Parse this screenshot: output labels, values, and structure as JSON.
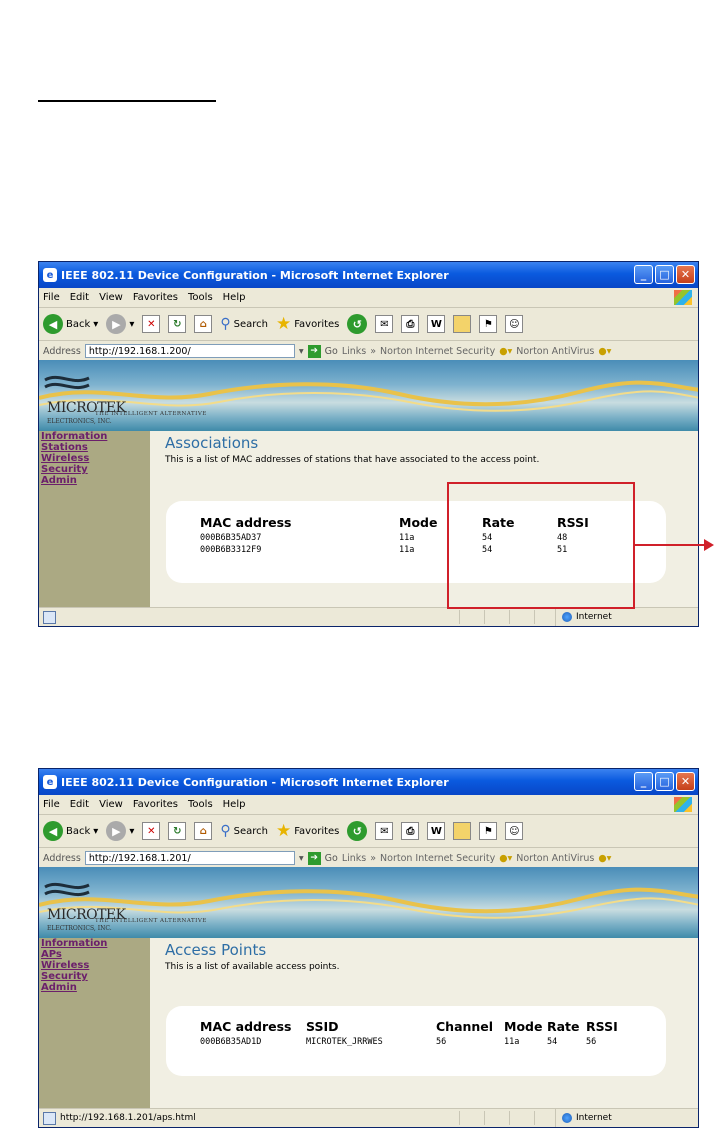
{
  "windows": [
    {
      "title": "IEEE 802.11 Device Configuration - Microsoft Internet Explorer",
      "menu": [
        "File",
        "Edit",
        "View",
        "Favorites",
        "Tools",
        "Help"
      ],
      "toolbar": {
        "back": "Back",
        "search": "Search",
        "favorites": "Favorites"
      },
      "address": {
        "label": "Address",
        "value": "http://192.168.1.200/",
        "go": "Go",
        "links": "Links",
        "ext1": "Norton Internet Security",
        "ext2": "Norton AntiVirus"
      },
      "brand": {
        "logo": "MICROTEK",
        "logo_sub": "ELECTRONICS, INC.",
        "tagline": "THE INTELLIGENT ALTERNATIVE"
      },
      "sidebar": [
        "Information",
        "Stations",
        "Wireless",
        "Security",
        "Admin"
      ],
      "page": {
        "title": "Associations",
        "description": "This is a list of MAC addresses of stations that have associated to the access point."
      },
      "table": {
        "headers": [
          "MAC address",
          "Mode",
          "Rate",
          "RSSI"
        ],
        "rows": [
          [
            "000B6B35AD37",
            "11a",
            "54",
            "48"
          ],
          [
            "000B6B3312F9",
            "11a",
            "54",
            "51"
          ]
        ]
      },
      "status": {
        "left": "",
        "zone": "Internet"
      }
    },
    {
      "title": "IEEE 802.11 Device Configuration - Microsoft Internet Explorer",
      "menu": [
        "File",
        "Edit",
        "View",
        "Favorites",
        "Tools",
        "Help"
      ],
      "toolbar": {
        "back": "Back",
        "search": "Search",
        "favorites": "Favorites"
      },
      "address": {
        "label": "Address",
        "value": "http://192.168.1.201/",
        "go": "Go",
        "links": "Links",
        "ext1": "Norton Internet Security",
        "ext2": "Norton AntiVirus"
      },
      "brand": {
        "logo": "MICROTEK",
        "logo_sub": "ELECTRONICS, INC.",
        "tagline": "THE INTELLIGENT ALTERNATIVE"
      },
      "sidebar": [
        "Information",
        "APs",
        "Wireless",
        "Security",
        "Admin"
      ],
      "page": {
        "title": "Access Points",
        "description": "This is a list of available access points."
      },
      "table": {
        "headers": [
          "MAC address",
          "SSID",
          "Channel",
          "Mode",
          "Rate",
          "RSSI"
        ],
        "rows": [
          [
            "000B6B35AD1D",
            "MICROTEK_JRRWES",
            "56",
            "11a",
            "54",
            "56"
          ]
        ]
      },
      "status": {
        "left": "http://192.168.1.201/aps.html",
        "zone": "Internet"
      }
    }
  ],
  "annotation": {
    "color": "#d0202a"
  }
}
